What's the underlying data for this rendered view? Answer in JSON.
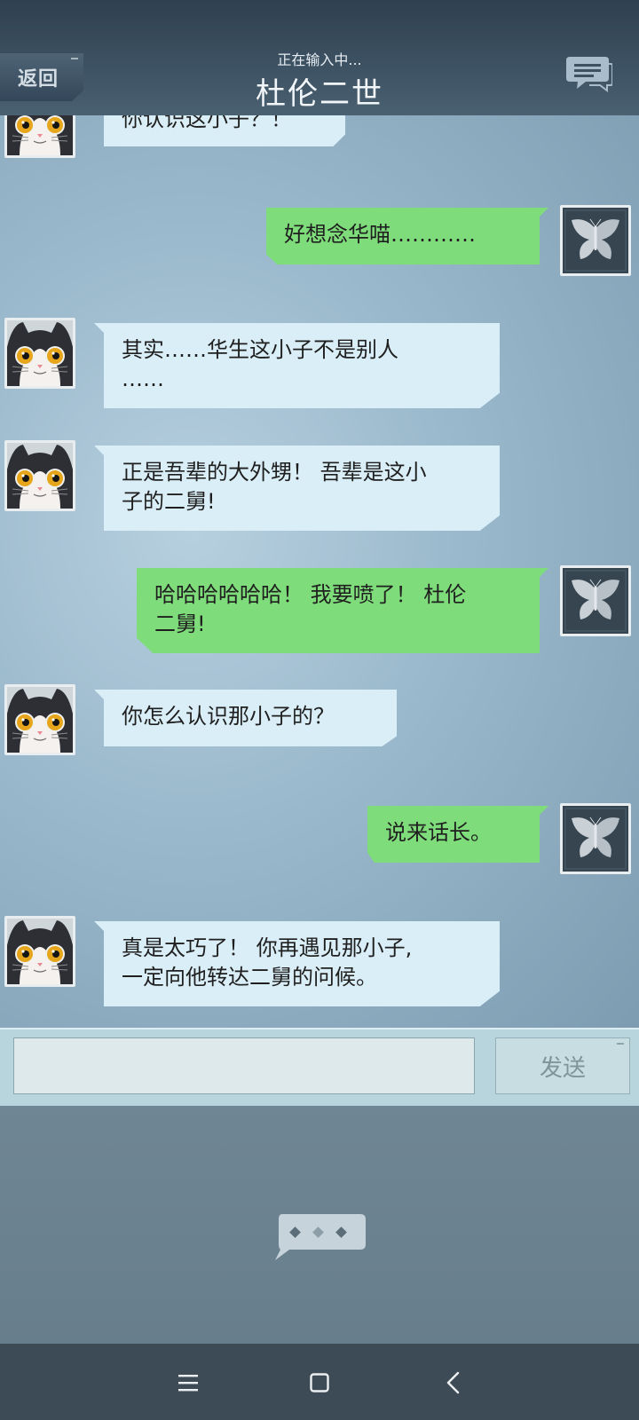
{
  "header": {
    "back_label": "返回",
    "typing_status": "正在输入中...",
    "contact_name": "杜伦二世"
  },
  "messages": [
    {
      "side": "left",
      "avatar": "cat-avatar",
      "text": "你认识这小子？！"
    },
    {
      "side": "right",
      "avatar": "butterfly-avatar",
      "text": "好想念华喵…………"
    },
    {
      "side": "left",
      "avatar": "cat-avatar",
      "line1": "其实……华生这小子不是别人",
      "line2": "……"
    },
    {
      "side": "left",
      "avatar": "cat-avatar",
      "line1": "正是吾辈的大外甥！ 吾辈是这小",
      "line2": "子的二舅!"
    },
    {
      "side": "right",
      "avatar": "butterfly-avatar",
      "line1": "哈哈哈哈哈哈！ 我要喷了！ 杜伦",
      "line2": "二舅!"
    },
    {
      "side": "left",
      "avatar": "cat-avatar",
      "text": "你怎么认识那小子的？"
    },
    {
      "side": "right",
      "avatar": "butterfly-avatar",
      "text": "说来话长。"
    },
    {
      "side": "left",
      "avatar": "cat-avatar",
      "line1": "真是太巧了！ 你再遇见那小子,",
      "line2": "一定向他转达二舅的问候。"
    }
  ],
  "composer": {
    "input_value": "",
    "send_label": "发送"
  },
  "icons": {
    "header_right": "chat-bubbles-icon",
    "more": "ellipsis-bubble-icon",
    "nav": [
      "menu-icon",
      "home-icon",
      "back-icon"
    ]
  },
  "colors": {
    "incoming_bubble": "#d9eef6",
    "outgoing_bubble": "#7fdc7b",
    "header": "#3c5162",
    "navbar": "#3d4b56"
  }
}
